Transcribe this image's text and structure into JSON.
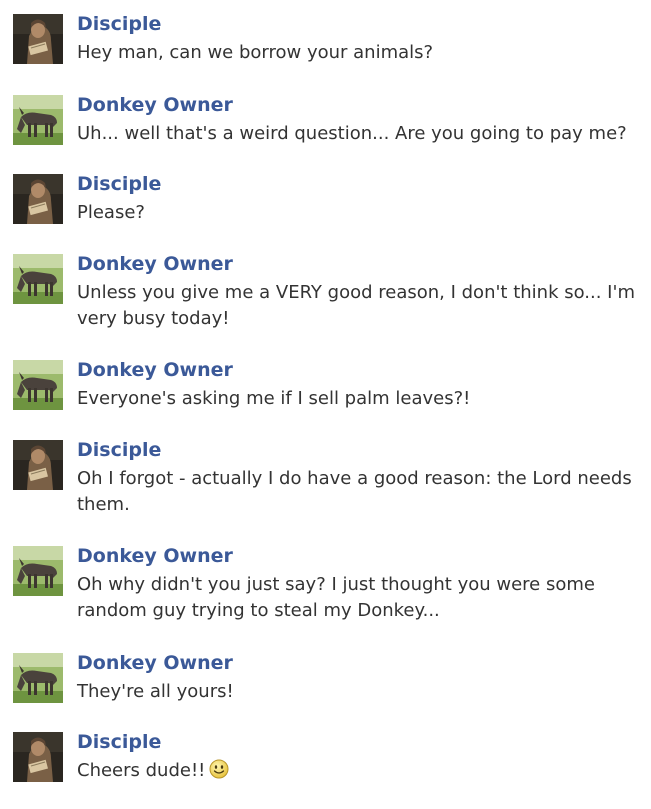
{
  "conversation": {
    "messages": [
      {
        "sender": "Disciple",
        "avatar": "disciple-avatar",
        "text": "Hey man, can we borrow your animals?"
      },
      {
        "sender": "Donkey Owner",
        "avatar": "donkey-avatar",
        "text": "Uh... well that's a weird question... Are you going to pay me?"
      },
      {
        "sender": "Disciple",
        "avatar": "disciple-avatar",
        "text": "Please?"
      },
      {
        "sender": "Donkey Owner",
        "avatar": "donkey-avatar",
        "text": "Unless you give me a VERY good reason, I don't think so... I'm very busy today!"
      },
      {
        "sender": "Donkey Owner",
        "avatar": "donkey-avatar",
        "text": "Everyone's asking me if I sell palm leaves?!"
      },
      {
        "sender": "Disciple",
        "avatar": "disciple-avatar",
        "text": "Oh I forgot - actually I do have a good reason: the Lord needs them."
      },
      {
        "sender": "Donkey Owner",
        "avatar": "donkey-avatar",
        "text": "Oh why didn't you just say? I just thought you were some random guy trying to steal my Donkey..."
      },
      {
        "sender": "Donkey Owner",
        "avatar": "donkey-avatar",
        "text": "They're all yours!"
      },
      {
        "sender": "Disciple",
        "avatar": "disciple-avatar",
        "text": "Cheers dude!!",
        "emoji": "smiley-icon"
      }
    ]
  },
  "colors": {
    "name": "#3b5998",
    "text": "#333333"
  }
}
